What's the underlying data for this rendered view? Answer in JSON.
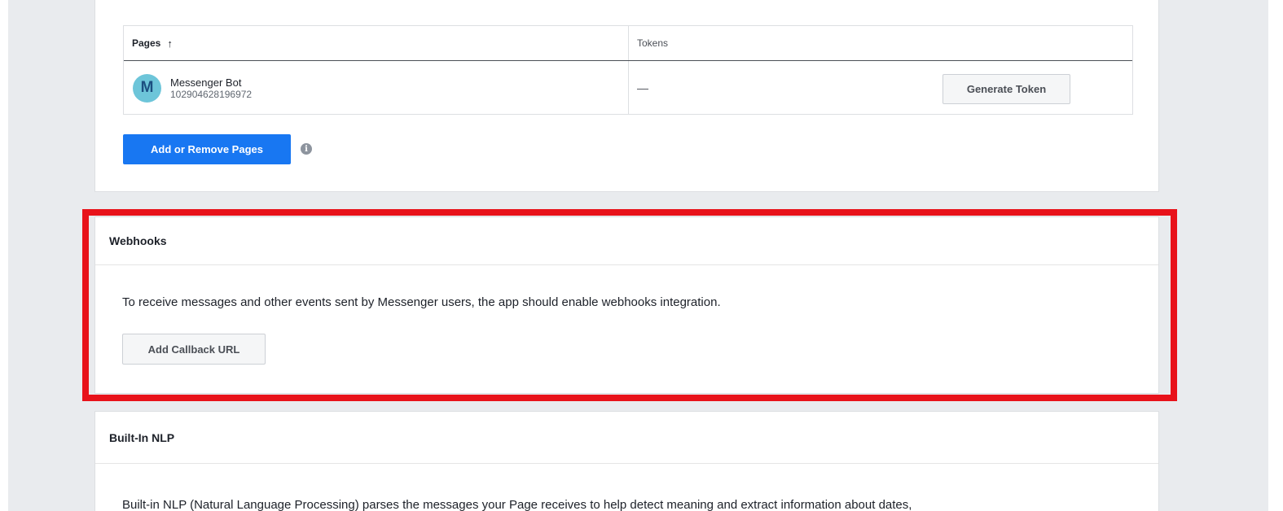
{
  "pages_table": {
    "headers": {
      "pages": "Pages",
      "pages_sort_icon": "↑",
      "tokens": "Tokens"
    },
    "rows": [
      {
        "avatar_letter": "M",
        "page_name": "Messenger Bot",
        "page_id": "102904628196972",
        "token": "—",
        "action_label": "Generate Token"
      }
    ]
  },
  "add_pages_label": "Add or Remove Pages",
  "info_icon_glyph": "i",
  "webhooks": {
    "title": "Webhooks",
    "description": "To receive messages and other events sent by Messenger users, the app should enable webhooks integration.",
    "button_label": "Add Callback URL"
  },
  "nlp": {
    "title": "Built-In NLP",
    "description": "Built-in NLP (Natural Language Processing) parses the messages your Page receives to help detect meaning and extract information about dates,"
  },
  "colors": {
    "primary_button": "#1877f2",
    "highlight": "#e8121a",
    "avatar_bg": "#6dc5d9",
    "page_background": "#e9ebee"
  }
}
